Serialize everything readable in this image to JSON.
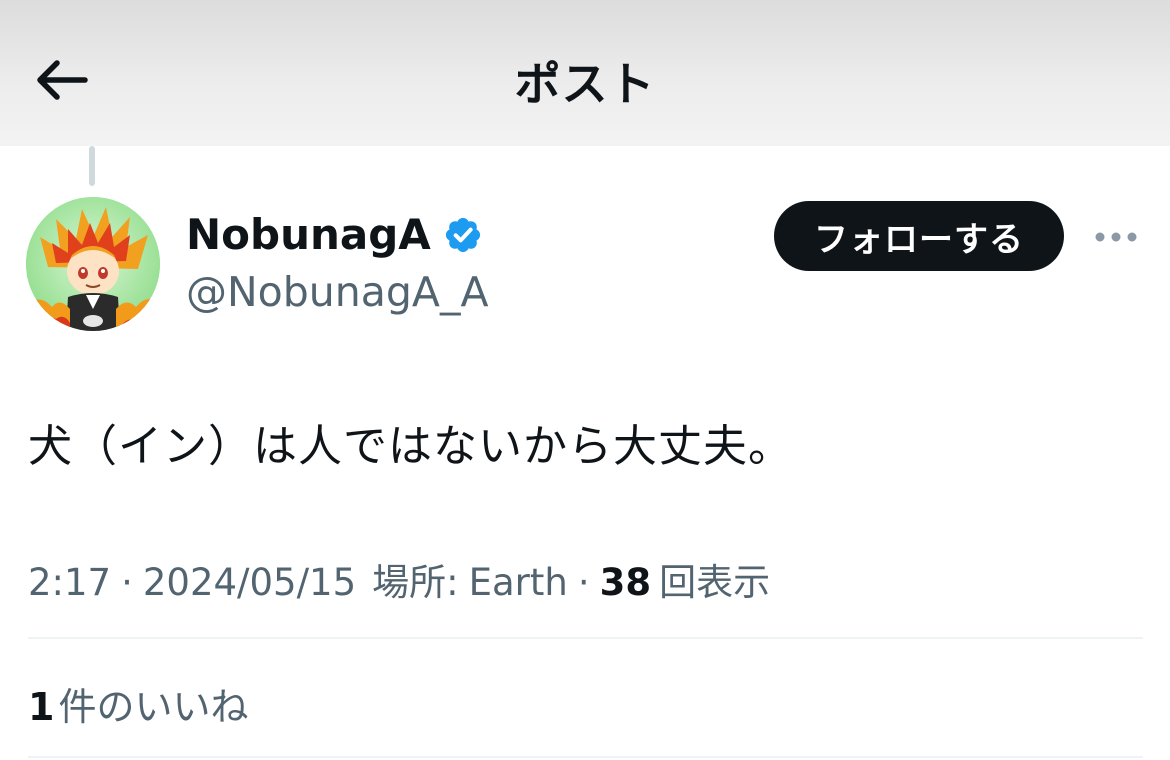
{
  "header": {
    "title": "ポスト",
    "back_icon": "arrow-left-icon"
  },
  "author": {
    "display_name": "NobunagA",
    "handle": "@NobunagA_A",
    "verified": true,
    "verified_color": "#1d9bf0"
  },
  "actions": {
    "follow_label": "フォローする",
    "more_icon": "more-horizontal-icon"
  },
  "tweet": {
    "text": "犬（イン）は人ではないから大丈夫。",
    "time": "2:17",
    "date": "2024/05/15",
    "location_label": "場所:",
    "location": "Earth",
    "views_count": "38",
    "views_label": "回表示"
  },
  "engagement": {
    "likes_count": "1",
    "likes_label": "件のいいね"
  },
  "colors": {
    "text_primary": "#0f1419",
    "text_secondary": "#536471",
    "follow_bg": "#0f1419",
    "divider": "#eff3f4"
  }
}
